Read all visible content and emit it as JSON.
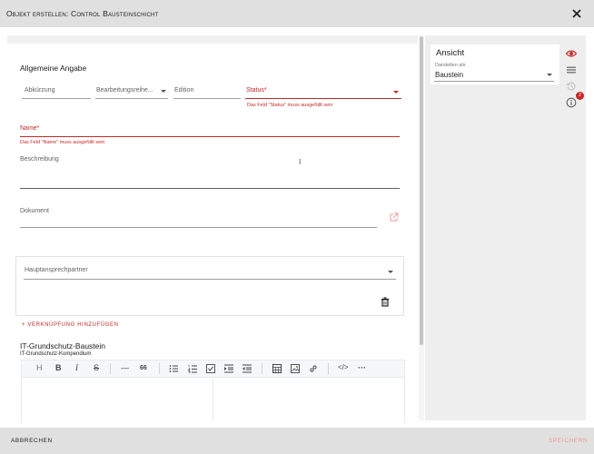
{
  "dialog": {
    "title": "Objekt erstellen: Control Bausteinschicht"
  },
  "form": {
    "section_title": "Allgemeine Angabe",
    "abkuerzung_label": "Abkürzung",
    "bearbeitungsreihe_label": "Bearbeitungsreihe...",
    "edition_label": "Edition",
    "status_label": "Status*",
    "status_error": "Das Feld \"Status\" muss ausgefüllt sein",
    "name_label": "Name*",
    "name_error": "Das Feld \"Name\" muss ausgefüllt sein",
    "beschreibung_label": "Beschreibung",
    "dokument_label": "Dokument",
    "hauptansprechpartner_label": "Hauptansprechpartner",
    "add_link_label": "+  VERKNÜPFUNG HINZUFÜGEN",
    "grundschutz_title": "IT-Grundschutz-Baustein",
    "grundschutz_subtitle": "IT-Grundschutz-Kompendium"
  },
  "toolbar": {
    "heading": "H",
    "bold": "B",
    "italic": "I",
    "strike": "S",
    "hr": "—",
    "quote": "66",
    "code": "</>",
    "more": "···"
  },
  "sidebar": {
    "ansicht_title": "Ansicht",
    "darstellen_label": "Darstellen als",
    "darstellen_value": "Baustein",
    "badge_count": "2"
  },
  "footer": {
    "cancel_label": "ABBRECHEN",
    "save_label": "SPEICHERN"
  },
  "colors": {
    "accent": "#c62828",
    "disabled": "#ef9a9a"
  }
}
